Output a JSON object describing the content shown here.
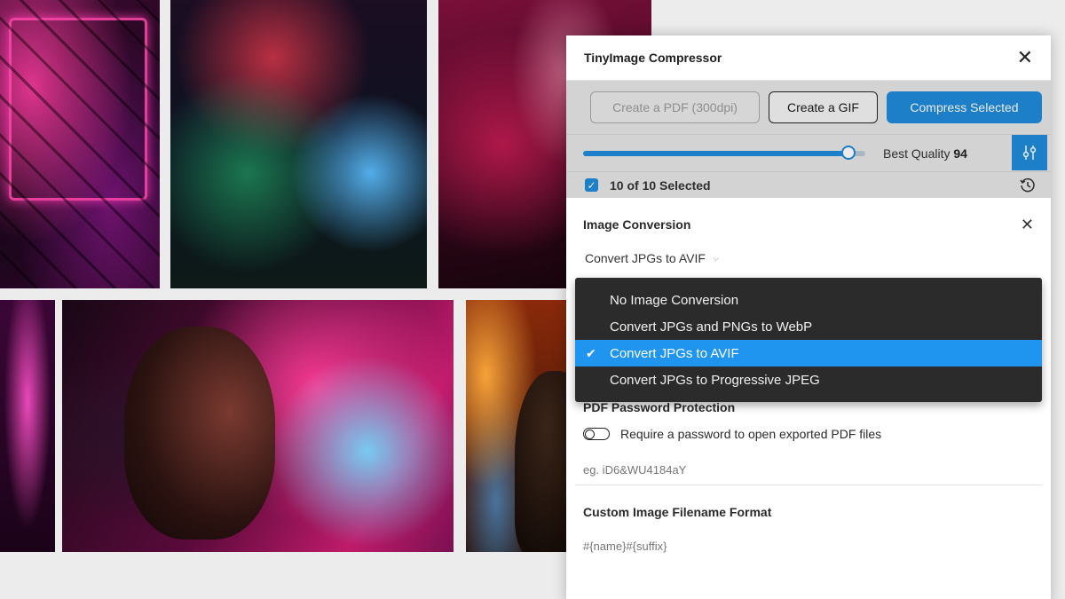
{
  "panel": {
    "title": "TinyImage Compressor"
  },
  "toolbar": {
    "pdf_button": "Create a PDF (300dpi)",
    "gif_button": "Create a GIF",
    "compress_button": "Compress Selected"
  },
  "quality": {
    "label": "Best Quality",
    "value": "94",
    "slider_fraction": 0.94
  },
  "selection": {
    "label": "10 of 10 Selected"
  },
  "image_conversion": {
    "title": "Image Conversion",
    "selected": "Convert JPGs to AVIF",
    "options": [
      "No Image Conversion",
      "Convert JPGs and PNGs to WebP",
      "Convert JPGs to AVIF",
      "Convert JPGs to Progressive JPEG"
    ],
    "active_index": 2
  },
  "pdf_protection": {
    "title": "PDF Password Protection",
    "toggle_label": "Require a password to open exported PDF files",
    "placeholder": "eg. iD6&WU4184aY"
  },
  "filename_format": {
    "title": "Custom Image Filename Format",
    "placeholder": "#{name}#{suffix}"
  },
  "colors": {
    "accent": "#1f8ad9",
    "dropdown_bg": "#2b2b2b",
    "dropdown_active": "#1f95f0"
  }
}
